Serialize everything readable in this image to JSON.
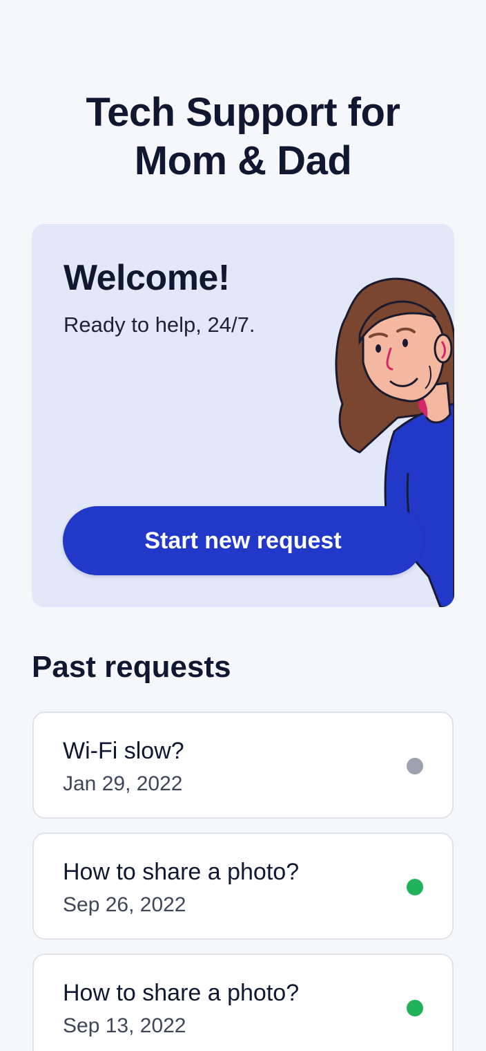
{
  "app": {
    "title_line1": "Tech Support for",
    "title_line2": "Mom & Dad"
  },
  "hero": {
    "title": "Welcome!",
    "subtitle": "Ready to help, 24/7.",
    "illustration": "smiling-woman-illustration",
    "cta_label": "Start new request"
  },
  "past_requests": {
    "title": "Past requests",
    "items": [
      {
        "title": "Wi-Fi slow?",
        "date": "Jan 29, 2022",
        "status_color": "#9ca3af"
      },
      {
        "title": "How to share a photo?",
        "date": "Sep 26, 2022",
        "status_color": "#22b35a"
      },
      {
        "title": "How to share a photo?",
        "date": "Sep 13, 2022",
        "status_color": "#22b35a"
      }
    ]
  },
  "colors": {
    "accent": "#2238c9",
    "card_bg": "#e3e8f8",
    "page_bg": "#f6f7fb"
  }
}
